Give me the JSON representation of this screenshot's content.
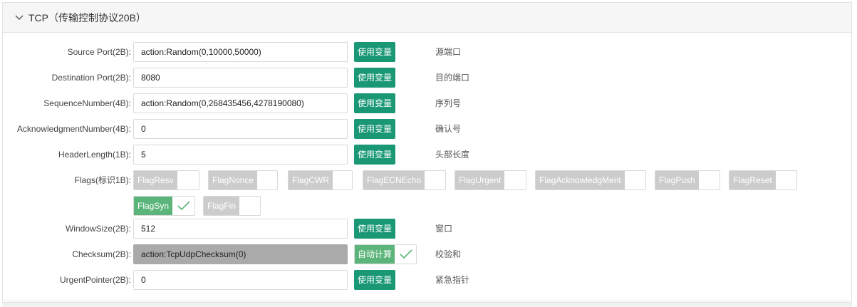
{
  "header": {
    "title": "TCP（传输控制协议20B）"
  },
  "fields": {
    "source_port": {
      "label": "Source Port(2B):",
      "value": "action:Random(0,10000,50000)",
      "button": "使用变量",
      "desc": "源端口"
    },
    "dest_port": {
      "label": "Destination Port(2B):",
      "value": "8080",
      "button": "使用变量",
      "desc": "目的端口"
    },
    "seq": {
      "label": "SequenceNumber(4B):",
      "value": "action:Random(0,268435456,4278190080)",
      "button": "使用变量",
      "desc": "序列号"
    },
    "ack": {
      "label": "AcknowledgmentNumber(4B):",
      "value": "0",
      "button": "使用变量",
      "desc": "确认号"
    },
    "hlen": {
      "label": "HeaderLength(1B):",
      "value": "5",
      "button": "使用变量",
      "desc": "头部长度"
    },
    "flags": {
      "label": "Flags(标识1B):"
    },
    "window": {
      "label": "WindowSize(2B):",
      "value": "512",
      "button": "使用变量",
      "desc": "窗口"
    },
    "checksum": {
      "label": "Checksum(2B):",
      "value": "action:TcpUdpChecksum(0)",
      "button": "自动计算",
      "desc": "校验和"
    },
    "urgent": {
      "label": "UrgentPointer(2B):",
      "value": "0",
      "button": "使用变量",
      "desc": "紧急指针"
    }
  },
  "flag_items": [
    {
      "label": "FlagResv",
      "checked": false
    },
    {
      "label": "FlagNonce",
      "checked": false
    },
    {
      "label": "FlagCWR",
      "checked": false
    },
    {
      "label": "FlagECNEcho",
      "checked": false
    },
    {
      "label": "FlagUrgent",
      "checked": false
    },
    {
      "label": "FlagAcknowledgMent",
      "checked": false
    },
    {
      "label": "FlagPush",
      "checked": false
    },
    {
      "label": "FlagReset",
      "checked": false
    },
    {
      "label": "FlagSyn",
      "checked": true
    },
    {
      "label": "FlagFin",
      "checked": false
    }
  ],
  "colors": {
    "accent": "#1a9876",
    "checked": "#5bb57a",
    "unchecked": "#cccccc",
    "disabled_input": "#aaaaaa"
  },
  "icons": {
    "collapse": "chevron-down-icon",
    "check": "check-icon"
  }
}
